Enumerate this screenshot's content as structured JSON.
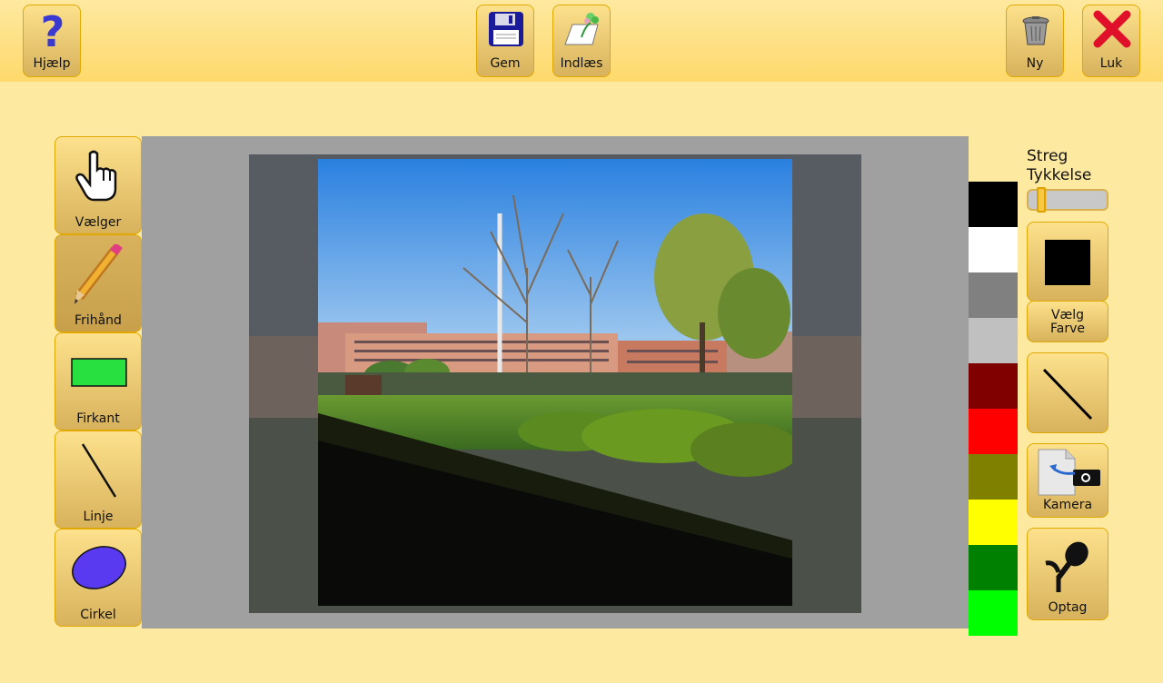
{
  "toolbar": {
    "help": "Hjælp",
    "save": "Gem",
    "load": "Indlæs",
    "new": "Ny",
    "close": "Luk"
  },
  "tools": [
    {
      "label": "Vælger",
      "icon": "hand-pointer-icon"
    },
    {
      "label": "Frihånd",
      "icon": "pencil-icon",
      "selected": true
    },
    {
      "label": "Firkant",
      "icon": "rectangle-icon"
    },
    {
      "label": "Linje",
      "icon": "line-icon"
    },
    {
      "label": "Cirkel",
      "icon": "ellipse-icon"
    }
  ],
  "palette": {
    "colors": [
      "#000000",
      "#ffffff",
      "#808080",
      "#c0c0c0",
      "#800000",
      "#ff0000",
      "#808000",
      "#ffff00",
      "#008000",
      "#00ff00"
    ]
  },
  "stroke": {
    "label_line1": "Streg",
    "label_line2": "Tykkelse",
    "thickness": 0.1
  },
  "color_picker": {
    "label_line1": "Vælg",
    "label_line2": "Farve",
    "current_color": "#000000"
  },
  "camera": {
    "label": "Kamera"
  },
  "record": {
    "label": "Optag"
  },
  "colors": {
    "background": "#fee9a0",
    "button_border": "#e0a800",
    "canvas_bg": "#a0a0a0"
  }
}
